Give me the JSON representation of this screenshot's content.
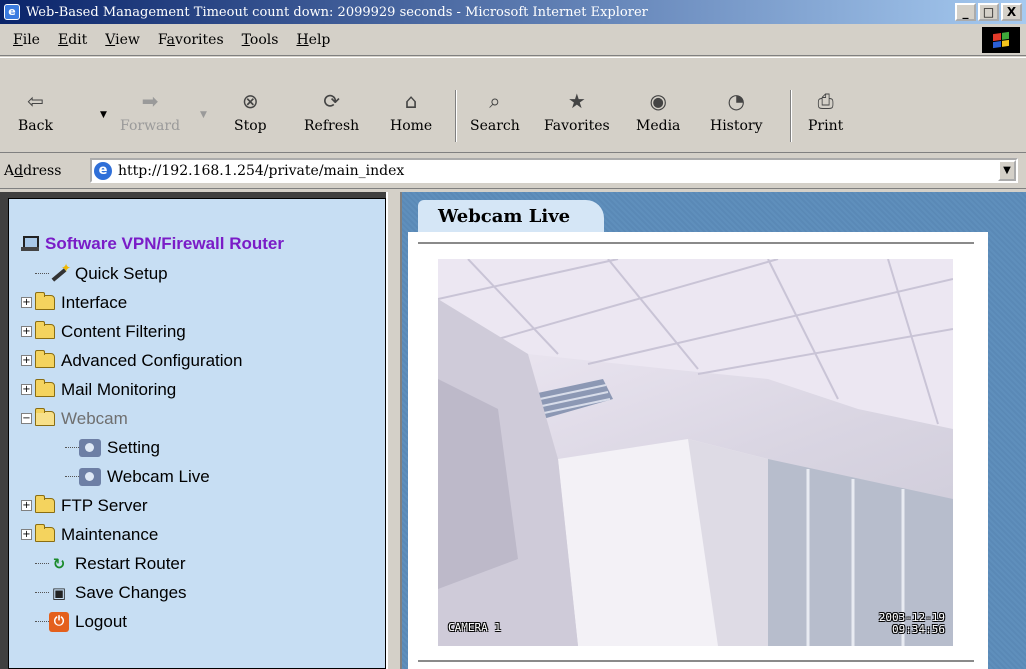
{
  "window": {
    "title": "Web-Based Management Timeout count down: 2099929 seconds - Microsoft Internet Explorer",
    "minimize": "_",
    "maximize": "□",
    "close": "X"
  },
  "menu": {
    "items": [
      {
        "ul": "F",
        "rest": "ile"
      },
      {
        "ul": "E",
        "rest": "dit"
      },
      {
        "ul": "V",
        "rest": "iew"
      },
      {
        "ul": "",
        "pre": "F",
        "ul2": "a",
        "rest": "vorites"
      },
      {
        "ul": "T",
        "rest": "ools"
      },
      {
        "ul": "H",
        "rest": "elp"
      }
    ]
  },
  "toolbar": {
    "back": "Back",
    "forward": "Forward",
    "stop": "Stop",
    "refresh": "Refresh",
    "home": "Home",
    "search": "Search",
    "favorites": "Favorites",
    "media": "Media",
    "history": "History",
    "print": "Print"
  },
  "address": {
    "label_ul": "d",
    "label_pre": "A",
    "label_post": "dress",
    "url": "http://192.168.1.254/private/main_index"
  },
  "sidebar": {
    "root": "Software VPN/Firewall Router",
    "items": [
      {
        "label": "Quick Setup"
      },
      {
        "label": "Interface"
      },
      {
        "label": "Content Filtering"
      },
      {
        "label": "Advanced Configuration"
      },
      {
        "label": "Mail Monitoring"
      },
      {
        "label": "Webcam"
      },
      {
        "label": "Setting"
      },
      {
        "label": "Webcam Live"
      },
      {
        "label": "FTP Server"
      },
      {
        "label": "Maintenance"
      },
      {
        "label": "Restart Router"
      },
      {
        "label": "Save Changes"
      },
      {
        "label": "Logout"
      }
    ]
  },
  "main": {
    "tab_label": "Webcam Live",
    "camera_label": "CAMERA 1",
    "date": "2003-12-19",
    "time": "09:34:56"
  },
  "colors": {
    "title_bar": "#0a246a",
    "sidebar_bg": "#c7def3",
    "root_label": "#7a1cc7",
    "tab_bg": "#d5e6f6"
  }
}
